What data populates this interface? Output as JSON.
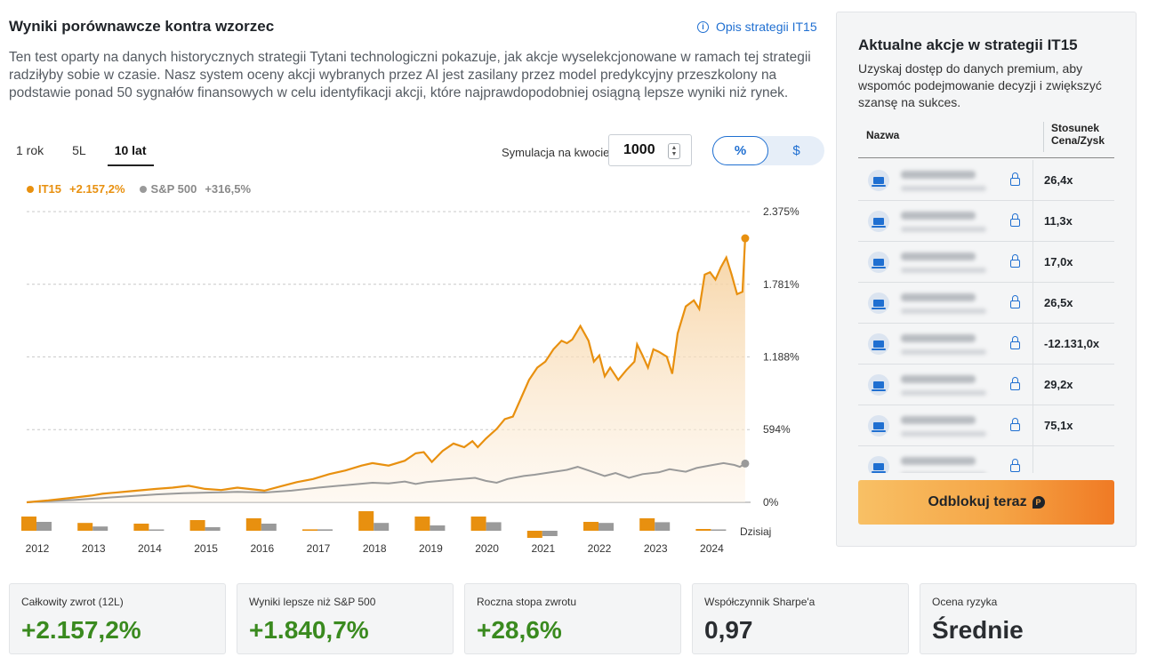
{
  "header": {
    "title": "Wyniki porównawcze kontra wzorzec",
    "strategy_link": "Opis strategii IT15",
    "description": "Ten test oparty na danych historycznych strategii Tytani technologiczni pokazuje, jak akcje wyselekcjonowane w ramach tej strategii radziłyby sobie w czasie. Nasz system oceny akcji wybranych przez AI jest zasilany przez model predykcyjny przeszkolony na podstawie ponad 50 sygnałów finansowych w celu identyfikacji akcji, które najprawdopodobniej osiągną lepsze wyniki niż rynek."
  },
  "tabs": [
    {
      "label": "1 rok",
      "active": false
    },
    {
      "label": "5L",
      "active": false
    },
    {
      "label": "10 lat",
      "active": true
    }
  ],
  "simulation": {
    "label": "Symulacja na kwocie",
    "value": "1000"
  },
  "toggle": {
    "percent": "%",
    "dollar": "$",
    "selected": "percent"
  },
  "legend": {
    "it15_name": "IT15",
    "it15_value": "+2.157,2%",
    "sp_name": "S&P 500",
    "sp_value": "+316,5%"
  },
  "colors": {
    "it15": "#e8900f",
    "sp500": "#9a9a9a",
    "accent": "#1f6fd1",
    "positive": "#3a8a1f"
  },
  "chart_data": {
    "type": "line",
    "y_ticks": [
      "2.375%",
      "1.781%",
      "1.188%",
      "594%",
      "0%"
    ],
    "y_tick_values": [
      2375,
      1781,
      1188,
      594,
      0
    ],
    "ylim": [
      0,
      2375
    ],
    "xlim": [
      2011.6,
      2025.0
    ],
    "grid": true,
    "series": [
      {
        "name": "IT15",
        "points": [
          [
            2011.6,
            0
          ],
          [
            2012.0,
            15
          ],
          [
            2012.5,
            40
          ],
          [
            2012.8,
            55
          ],
          [
            2013.0,
            70
          ],
          [
            2013.5,
            90
          ],
          [
            2014.0,
            110
          ],
          [
            2014.3,
            120
          ],
          [
            2014.6,
            135
          ],
          [
            2014.9,
            110
          ],
          [
            2015.2,
            100
          ],
          [
            2015.5,
            120
          ],
          [
            2015.8,
            105
          ],
          [
            2016.0,
            95
          ],
          [
            2016.3,
            130
          ],
          [
            2016.6,
            165
          ],
          [
            2016.9,
            190
          ],
          [
            2017.2,
            230
          ],
          [
            2017.5,
            260
          ],
          [
            2017.8,
            300
          ],
          [
            2018.0,
            320
          ],
          [
            2018.3,
            300
          ],
          [
            2018.6,
            340
          ],
          [
            2018.8,
            400
          ],
          [
            2018.95,
            410
          ],
          [
            2019.1,
            330
          ],
          [
            2019.3,
            420
          ],
          [
            2019.5,
            480
          ],
          [
            2019.7,
            450
          ],
          [
            2019.85,
            500
          ],
          [
            2019.95,
            450
          ],
          [
            2020.1,
            520
          ],
          [
            2020.3,
            600
          ],
          [
            2020.45,
            680
          ],
          [
            2020.6,
            700
          ],
          [
            2020.75,
            850
          ],
          [
            2020.9,
            1000
          ],
          [
            2021.05,
            1100
          ],
          [
            2021.2,
            1150
          ],
          [
            2021.35,
            1250
          ],
          [
            2021.5,
            1320
          ],
          [
            2021.6,
            1300
          ],
          [
            2021.7,
            1330
          ],
          [
            2021.85,
            1440
          ],
          [
            2022.0,
            1320
          ],
          [
            2022.1,
            1150
          ],
          [
            2022.2,
            1200
          ],
          [
            2022.3,
            1030
          ],
          [
            2022.4,
            1100
          ],
          [
            2022.55,
            1000
          ],
          [
            2022.7,
            1080
          ],
          [
            2022.85,
            1150
          ],
          [
            2022.9,
            1290
          ],
          [
            2023.0,
            1200
          ],
          [
            2023.1,
            1100
          ],
          [
            2023.2,
            1250
          ],
          [
            2023.3,
            1230
          ],
          [
            2023.45,
            1190
          ],
          [
            2023.55,
            1050
          ],
          [
            2023.65,
            1380
          ],
          [
            2023.8,
            1600
          ],
          [
            2023.95,
            1650
          ],
          [
            2024.05,
            1580
          ],
          [
            2024.15,
            1860
          ],
          [
            2024.25,
            1880
          ],
          [
            2024.35,
            1820
          ],
          [
            2024.45,
            1920
          ],
          [
            2024.55,
            2000
          ],
          [
            2024.65,
            1860
          ],
          [
            2024.75,
            1700
          ],
          [
            2024.85,
            1720
          ],
          [
            2024.9,
            2157
          ]
        ]
      },
      {
        "name": "S&P 500",
        "points": [
          [
            2011.6,
            0
          ],
          [
            2012.0,
            10
          ],
          [
            2012.5,
            20
          ],
          [
            2013.0,
            35
          ],
          [
            2013.5,
            50
          ],
          [
            2014.0,
            65
          ],
          [
            2014.5,
            75
          ],
          [
            2015.0,
            80
          ],
          [
            2015.5,
            85
          ],
          [
            2016.0,
            80
          ],
          [
            2016.5,
            95
          ],
          [
            2017.0,
            120
          ],
          [
            2017.5,
            140
          ],
          [
            2018.0,
            160
          ],
          [
            2018.3,
            155
          ],
          [
            2018.6,
            170
          ],
          [
            2018.8,
            150
          ],
          [
            2019.0,
            165
          ],
          [
            2019.5,
            185
          ],
          [
            2019.9,
            200
          ],
          [
            2020.1,
            175
          ],
          [
            2020.3,
            160
          ],
          [
            2020.5,
            190
          ],
          [
            2020.8,
            215
          ],
          [
            2021.0,
            225
          ],
          [
            2021.3,
            245
          ],
          [
            2021.6,
            265
          ],
          [
            2021.8,
            290
          ],
          [
            2022.0,
            260
          ],
          [
            2022.3,
            215
          ],
          [
            2022.5,
            240
          ],
          [
            2022.75,
            200
          ],
          [
            2023.0,
            230
          ],
          [
            2023.3,
            245
          ],
          [
            2023.5,
            270
          ],
          [
            2023.8,
            250
          ],
          [
            2024.0,
            280
          ],
          [
            2024.3,
            305
          ],
          [
            2024.5,
            320
          ],
          [
            2024.7,
            305
          ],
          [
            2024.8,
            290
          ],
          [
            2024.9,
            316.5
          ]
        ]
      }
    ],
    "annual": {
      "years": [
        "2012",
        "2013",
        "2014",
        "2015",
        "2016",
        "2017",
        "2018",
        "2019",
        "2020",
        "2021",
        "2022",
        "2023",
        "2024"
      ],
      "it15": [
        40,
        22,
        20,
        30,
        35,
        4,
        55,
        40,
        40,
        -20,
        25,
        35,
        5
      ],
      "sp500": [
        25,
        12,
        0,
        10,
        20,
        4,
        22,
        15,
        24,
        -15,
        22,
        24,
        3
      ]
    },
    "today_label": "Dzisiaj"
  },
  "side_panel": {
    "title": "Aktualne akcje w strategii IT15",
    "text": "Uzyskaj dostęp do danych premium, aby wspomóc podejmowanie decyzji i zwiększyć szansę na sukces.",
    "col_name": "Nazwa",
    "col_pe_line1": "Stosunek",
    "col_pe_line2": "Cena/Zysk",
    "rows": [
      "26,4x",
      "11,3x",
      "17,0x",
      "26,5x",
      "-12.131,0x",
      "29,2x",
      "75,1x",
      ""
    ],
    "button": "Odblokuj teraz",
    "button_icon": "P"
  },
  "stats": [
    {
      "label": "Całkowity zwrot (12L)",
      "value": "+2.157,2%"
    },
    {
      "label": "Wyniki lepsze niż S&P 500",
      "value": "+1.840,7%"
    },
    {
      "label": "Roczna stopa zwrotu",
      "value": "+28,6%"
    },
    {
      "label": "Współczynnik Sharpe'a",
      "value": "0,97"
    },
    {
      "label": "Ocena ryzyka",
      "value": "Średnie"
    }
  ]
}
